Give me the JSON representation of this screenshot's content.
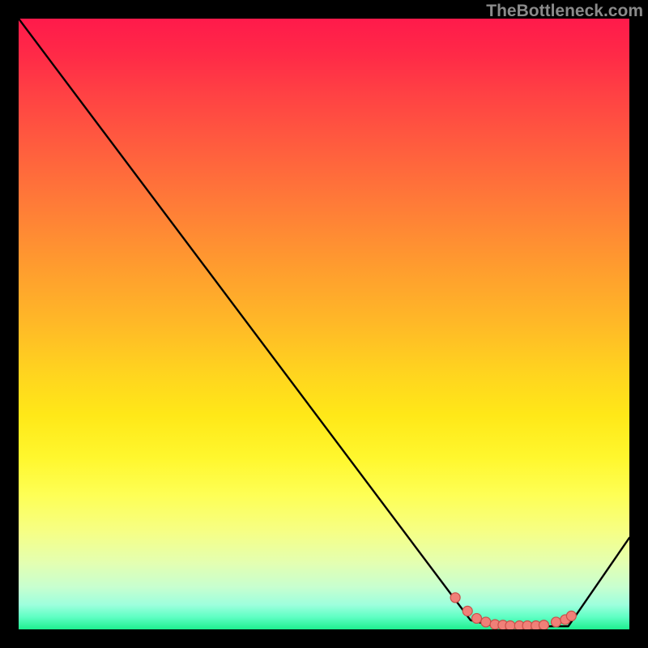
{
  "watermark": "TheBottleneck.com",
  "colors": {
    "background": "#000000",
    "curve": "#000000",
    "marker_fill": "#f08078",
    "marker_stroke": "#c94f49"
  },
  "chart_data": {
    "type": "line",
    "title": "",
    "xlabel": "",
    "ylabel": "",
    "xlim": [
      0,
      100
    ],
    "ylim": [
      0,
      100
    ],
    "grid": false,
    "series": [
      {
        "name": "bottleneck-curve",
        "x": [
          0,
          6,
          74,
          78,
          90,
          100
        ],
        "y": [
          100,
          92,
          1.5,
          0.5,
          0.5,
          15
        ]
      }
    ],
    "markers": {
      "name": "valley-markers",
      "x": [
        71.5,
        73.5,
        75,
        76.5,
        78,
        79.3,
        80.5,
        82,
        83.3,
        84.7,
        86,
        88,
        89.5,
        90.5
      ],
      "y": [
        5.2,
        3.0,
        1.8,
        1.2,
        0.8,
        0.7,
        0.6,
        0.6,
        0.6,
        0.6,
        0.7,
        1.2,
        1.6,
        2.2
      ]
    }
  }
}
